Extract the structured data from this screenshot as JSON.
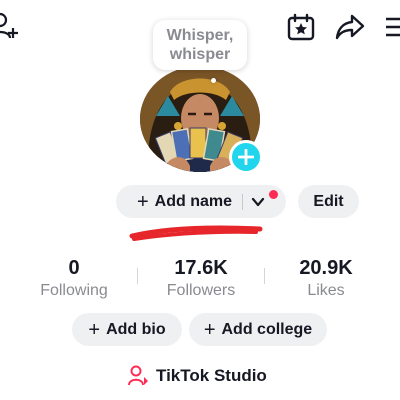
{
  "header": {
    "add_user_icon": "person-plus-icon",
    "calendar_icon": "calendar-star-icon",
    "share_icon": "share-arrow-icon",
    "menu_icon": "hamburger-menu-icon"
  },
  "profile": {
    "bubble_line1": "Whisper,",
    "bubble_line2": "whisper",
    "add_name_plus": "+",
    "add_name_label": "Add name",
    "edit_label": "Edit"
  },
  "stats": [
    {
      "value": "0",
      "label": "Following"
    },
    {
      "value": "17.6K",
      "label": "Followers"
    },
    {
      "value": "20.9K",
      "label": "Likes"
    }
  ],
  "actions": {
    "add_bio_plus": "+",
    "add_bio": "Add bio",
    "add_college_plus": "+",
    "add_college": "Add college"
  },
  "studio": {
    "label": "TikTok Studio",
    "icon": "person-studio-icon"
  },
  "colors": {
    "accent_cyan": "#20d5ec",
    "notification_red": "#fe2c55",
    "scribble_red": "#e6262b",
    "pill_bg": "#eff0f1",
    "muted_text": "#8a8b91"
  }
}
